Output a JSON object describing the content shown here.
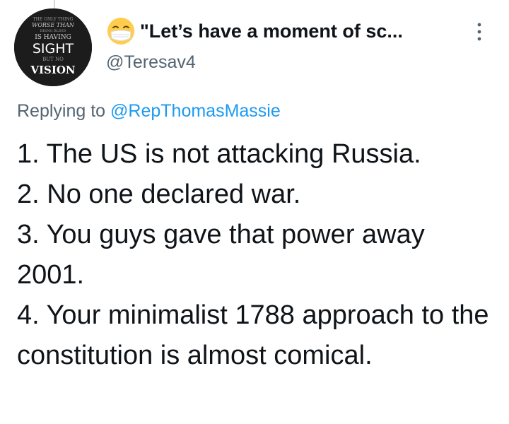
{
  "author": {
    "display_name": "\"Let’s have a moment of sc...",
    "handle": "@Teresav4",
    "emoji_icon": "face-with-medical-mask-icon",
    "avatar_text": {
      "line1": "THE ONLY THING",
      "line2": "WORSE THAN",
      "line3": "BEING BLIND",
      "line4": "IS HAVING",
      "line5": "SIGHT",
      "line6": "BUT NO",
      "line7": "VISION"
    }
  },
  "reply": {
    "prefix": "Replying to ",
    "mention": "@RepThomasMassie"
  },
  "tweet": {
    "lines": [
      "1. The US is not attacking Russia.",
      "2. No one declared war.",
      "3. You guys gave that power away 2001.",
      "4. Your minimalist 1788 approach to the constitution is almost comical."
    ]
  },
  "icons": {
    "more": "more-vertical-icon"
  },
  "colors": {
    "text": "#0f1419",
    "secondary": "#536471",
    "link": "#1d9bf0"
  }
}
